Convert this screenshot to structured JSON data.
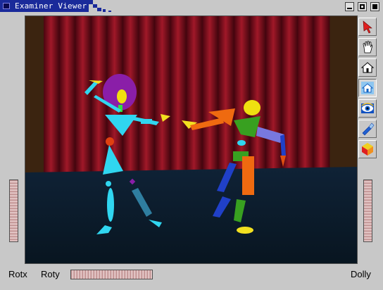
{
  "window": {
    "title": "Examiner Viewer",
    "title_bar_color": "#1a2a9a"
  },
  "window_controls": [
    "minimize-icon",
    "maximize-icon",
    "close-icon"
  ],
  "toolbar": {
    "tools": [
      {
        "name": "pick-arrow-icon",
        "active": false
      },
      {
        "name": "hand-view-icon",
        "active": false
      },
      {
        "name": "home-icon",
        "active": false
      },
      {
        "name": "set-home-icon",
        "active": true
      },
      {
        "name": "view-all-eye-icon",
        "active": false
      },
      {
        "name": "seek-flashlight-icon",
        "active": false
      },
      {
        "name": "projection-cube-icon",
        "active": false
      }
    ]
  },
  "wheels": {
    "rotx_label": "Rotx",
    "roty_label": "Roty",
    "dolly_label": "Dolly"
  },
  "scene": {
    "curtain_color": "#7a0f1c",
    "floor_color": "#0c1b2b",
    "wall_color": "#3b2410"
  }
}
